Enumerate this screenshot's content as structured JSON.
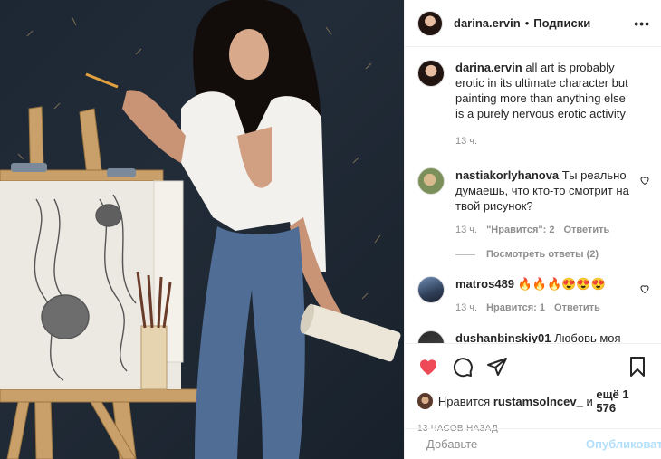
{
  "header": {
    "username": "darina.ervin",
    "separator": "•",
    "follow_label": "Подписки",
    "more_label": "•••"
  },
  "caption": {
    "username": "darina.ervin",
    "text": "all art is probably erotic in its ultimate character but painting more than anything else is a purely nervous erotic activity",
    "time": "13 ч."
  },
  "comments": [
    {
      "username": "nastiakorlyhanova",
      "text": "Ты реально думаешь, что кто-то смотрит на твой рисунок?",
      "time": "13 ч.",
      "likes": "\"Нравится\": 2",
      "reply_label": "Ответить",
      "view_replies": "Посмотреть ответы (2)"
    },
    {
      "username": "matros489",
      "text": "🔥🔥🔥😍😍😍",
      "time": "13 ч.",
      "likes": "Нравится: 1",
      "reply_label": "Ответить"
    },
    {
      "username": "dushanbinskiy01",
      "text": "Любовь моя ❤️"
    }
  ],
  "likes": {
    "prefix": "Нравится",
    "user": "rustamsolncev_",
    "middle": "и",
    "count": "ещё 1 576"
  },
  "post_time": "13 ЧАСОВ НАЗАД",
  "add_comment": {
    "placeholder": "Добавьте",
    "publish_label": "Опубликовать"
  },
  "icons": {
    "like": "heart-filled-icon",
    "comment": "comment-icon",
    "share": "paper-plane-icon",
    "save": "bookmark-icon",
    "emoji": "smiley-icon"
  },
  "colors": {
    "like_red": "#ed4956",
    "publish_disabled": "#b2dffc",
    "muted": "#8e8e8e"
  }
}
